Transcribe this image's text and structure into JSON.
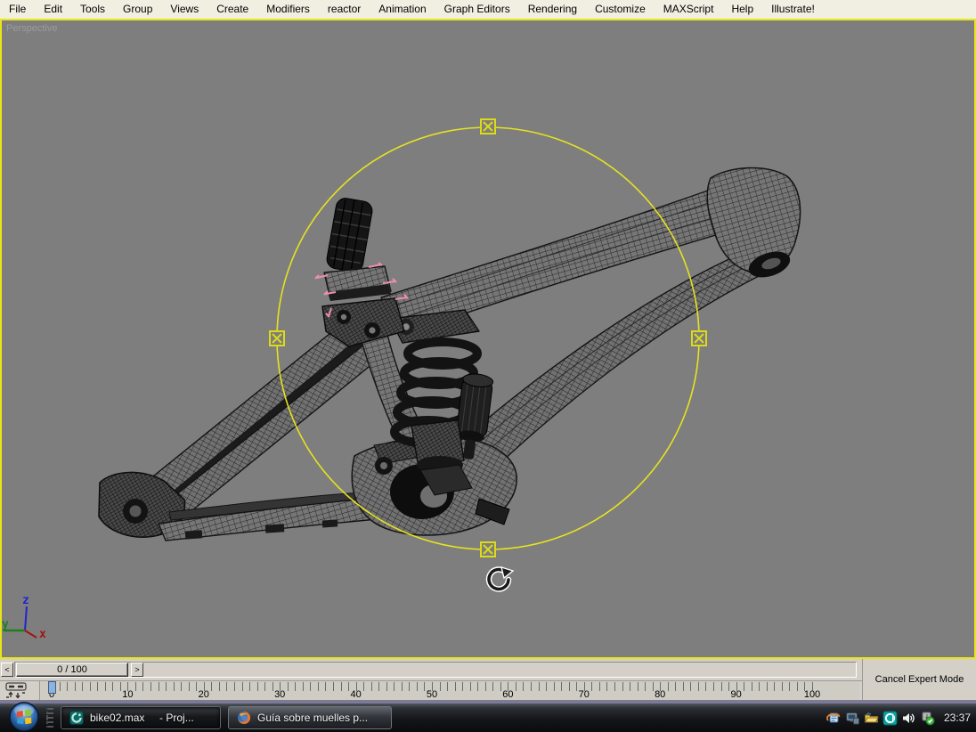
{
  "menu": {
    "items": [
      "File",
      "Edit",
      "Tools",
      "Group",
      "Views",
      "Create",
      "Modifiers",
      "reactor",
      "Animation",
      "Graph Editors",
      "Rendering",
      "Customize",
      "MAXScript",
      "Help",
      "Illustrate!"
    ]
  },
  "viewport": {
    "label": "Perspective",
    "axis_labels": {
      "x": "x",
      "y": "y",
      "z": "z"
    }
  },
  "timeline": {
    "frame_display": "0 / 100",
    "prev_label": "<",
    "next_label": ">",
    "tick_labels": [
      "0",
      "10",
      "20",
      "30",
      "40",
      "50",
      "60",
      "70",
      "80",
      "90",
      "100"
    ]
  },
  "expert": {
    "cancel_button": "Cancel Expert Mode"
  },
  "taskbar": {
    "tasks": [
      {
        "label": "bike02.max     - Proj...",
        "icon": "3dsmax-icon"
      },
      {
        "label": "Guía sobre muelles p...",
        "icon": "firefox-icon"
      }
    ],
    "tray_icons": [
      "sync-activity-icon",
      "display-device-icon",
      "shared-folder-icon",
      "media-player-icon",
      "volume-icon",
      "security-update-icon"
    ],
    "clock": "23:37"
  },
  "colors": {
    "gizmo_yellow": "#e6e31f",
    "viewport_bg": "#7e7e7e",
    "selection_pink": "#ee8fae"
  }
}
